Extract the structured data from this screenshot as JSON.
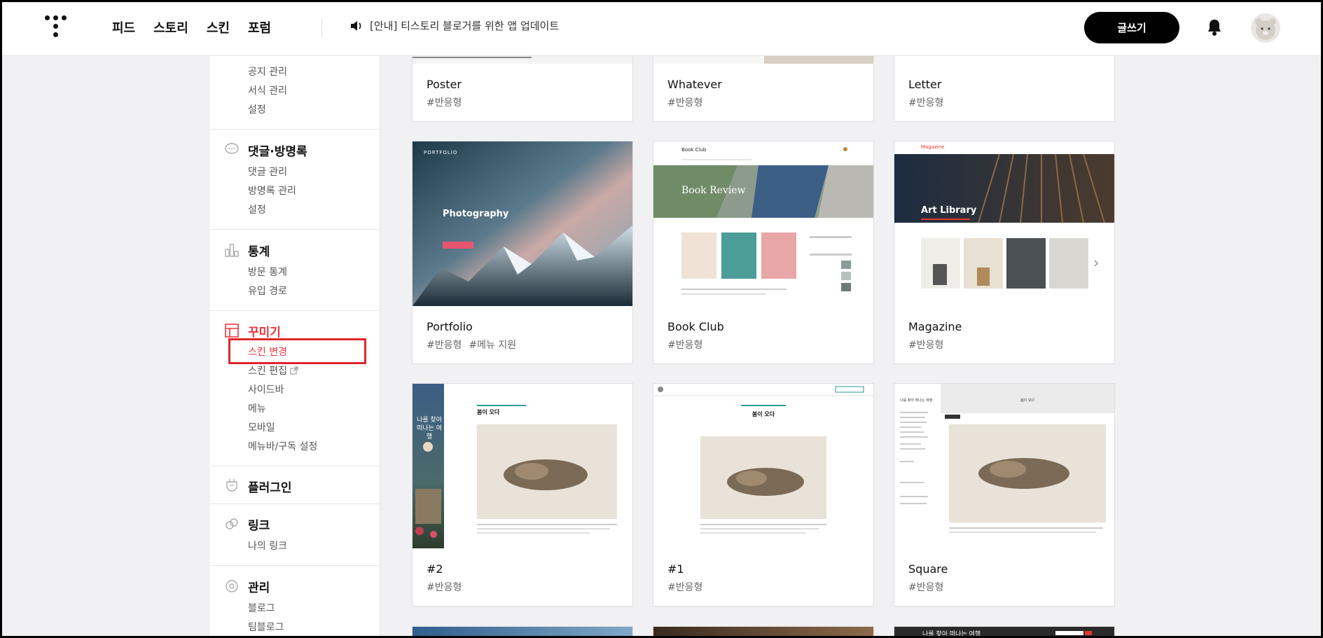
{
  "header": {
    "nav": [
      "피드",
      "스토리",
      "스킨",
      "포럼"
    ],
    "notice": "[안내] 티스토리 블로거를 위한 앱 업데이트",
    "write_button": "글쓰기"
  },
  "sidebar": {
    "top_items": [
      "공지 관리",
      "서식 관리",
      "설정"
    ],
    "sections": [
      {
        "title": "댓글·방명록",
        "icon": "comment-icon",
        "items": [
          "댓글 관리",
          "방명록 관리",
          "설정"
        ]
      },
      {
        "title": "통계",
        "icon": "chart-bar-icon",
        "items": [
          "방문 통계",
          "유입 경로"
        ]
      },
      {
        "title": "꾸미기",
        "icon": "layout-icon",
        "items": [
          "스킨 변경",
          "스킨 편집",
          "사이드바",
          "메뉴",
          "모바일",
          "메뉴바/구독 설정"
        ]
      },
      {
        "title": "플러그인",
        "icon": "plug-icon",
        "items": []
      },
      {
        "title": "링크",
        "icon": "link-icon",
        "items": [
          "나의 링크"
        ]
      },
      {
        "title": "관리",
        "icon": "gear-icon",
        "items": [
          "블로그",
          "팀블로그"
        ]
      }
    ]
  },
  "skins": [
    {
      "name": "Poster",
      "tags": [
        "#반응형"
      ]
    },
    {
      "name": "Whatever",
      "tags": [
        "#반응형"
      ]
    },
    {
      "name": "Letter",
      "tags": [
        "#반응형"
      ]
    },
    {
      "name": "Portfolio",
      "tags": [
        "#반응형",
        "#메뉴 지원"
      ],
      "thumb": {
        "brand": "PORTFOLIO",
        "headline": "Photography"
      }
    },
    {
      "name": "Book Club",
      "tags": [
        "#반응형"
      ],
      "thumb": {
        "brand": "Book Club",
        "headline": "Book Review"
      }
    },
    {
      "name": "Magazine",
      "tags": [
        "#반응형"
      ],
      "thumb": {
        "brand": "Magazine",
        "headline": "Art Library"
      }
    },
    {
      "name": "#2",
      "tags": [
        "#반응형"
      ],
      "thumb": {
        "side_title": "나를 찾아 떠나는 여행",
        "post_title": "봄이 오다"
      }
    },
    {
      "name": "#1",
      "tags": [
        "#반응형"
      ],
      "thumb": {
        "post_title": "봄이 오다"
      }
    },
    {
      "name": "Square",
      "tags": [
        "#반응형"
      ],
      "thumb": {
        "side_title": "나를 찾아 떠나는 여행",
        "post_title": "봄이 오다"
      }
    }
  ],
  "bottom_strip": {
    "text": "나를 찾아 떠나는 여행"
  },
  "colors": {
    "accent": "#f0353b",
    "highlight_box": "#e0262a"
  }
}
